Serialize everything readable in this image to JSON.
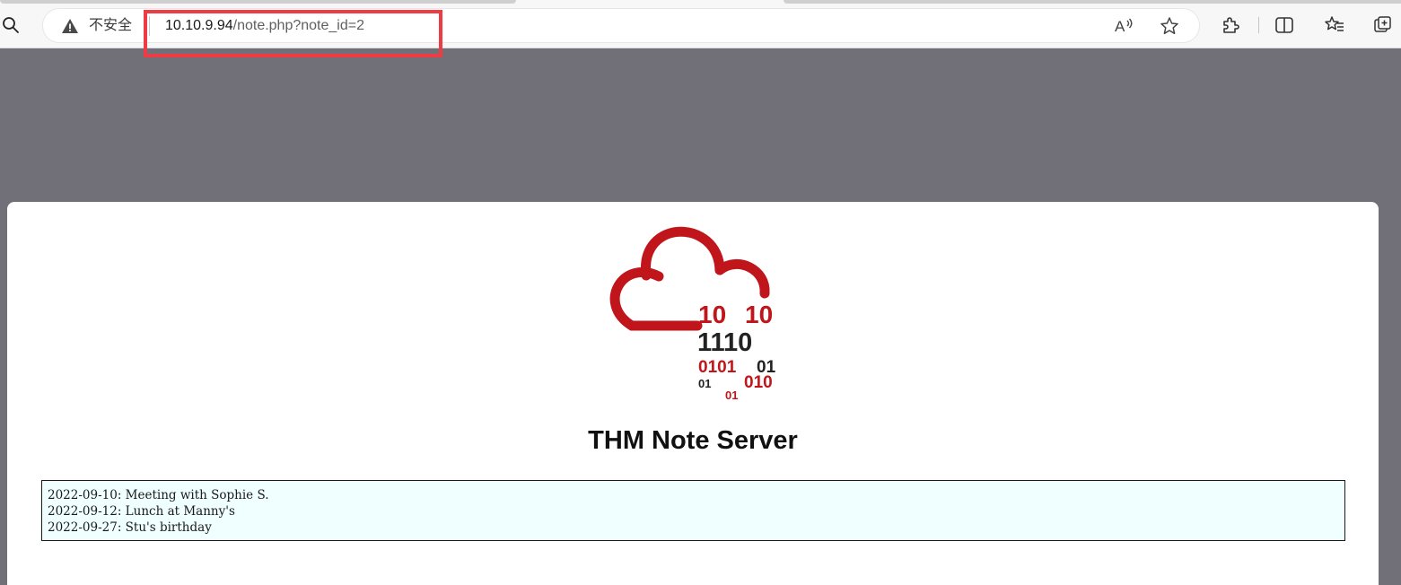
{
  "browser": {
    "address_bar": {
      "security_label": "不安全",
      "url_host": "10.10.9.94",
      "url_path": "/note.php?note_id=2"
    },
    "icons": {
      "search": "search-icon",
      "warning": "warning-icon",
      "read_aloud": "read-aloud-icon",
      "favorite": "star-icon",
      "extensions": "puzzle-icon",
      "split_screen": "split-screen-icon",
      "favorites": "favorites-list-icon",
      "collections": "collections-icon"
    },
    "annotation_color": "#ef3b43"
  },
  "page": {
    "logo": {
      "lines": [
        "10",
        "10",
        "1110",
        "0101",
        "01",
        "01",
        "010",
        "01"
      ],
      "primary_color": "#c0161b",
      "secondary_color": "#222222"
    },
    "title": "THM Note Server",
    "notes": [
      "2022-09-10: Meeting with Sophie S.",
      "2022-09-12: Lunch at Manny's",
      "2022-09-27: Stu's birthday"
    ]
  }
}
